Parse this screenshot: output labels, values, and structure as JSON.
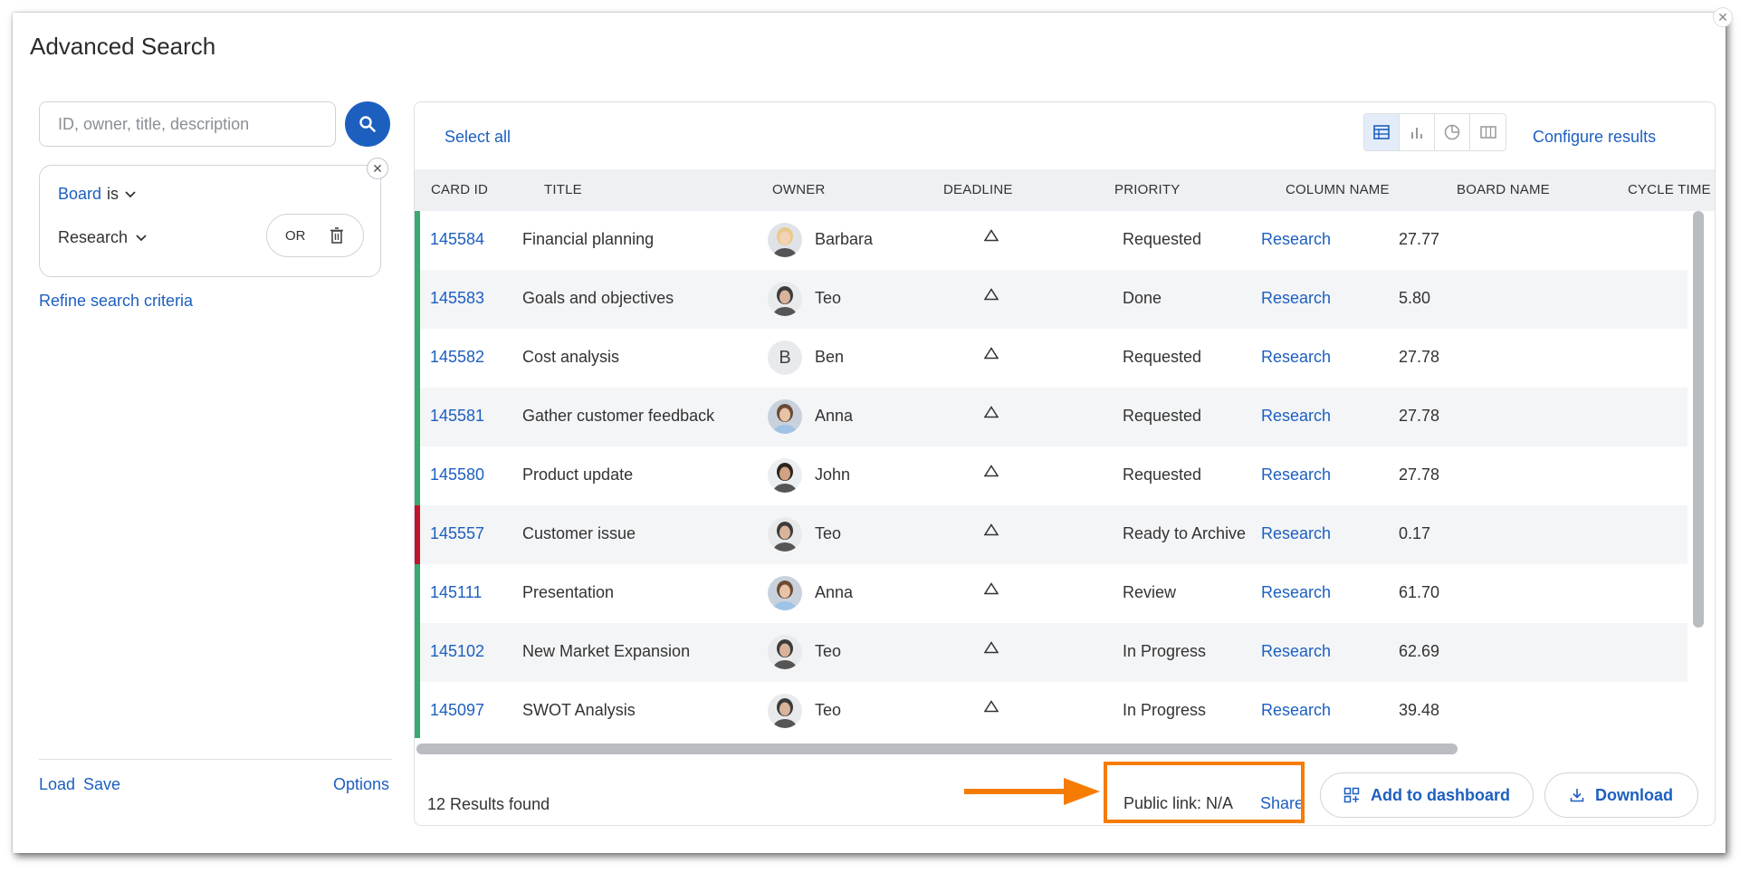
{
  "modal": {
    "title": "Advanced Search"
  },
  "search": {
    "placeholder": "ID, owner, title, description",
    "value": ""
  },
  "filter": {
    "field": "Board",
    "operator": "is",
    "value": "Research",
    "logic": "OR"
  },
  "left_links": {
    "refine": "Refine search criteria",
    "load": "Load",
    "save": "Save",
    "options": "Options"
  },
  "toolbar": {
    "select_all": "Select all",
    "configure": "Configure results",
    "views": [
      "table-view-icon",
      "bar-chart-view-icon",
      "pie-chart-view-icon",
      "columns-view-icon"
    ],
    "active_view": "table-view-icon"
  },
  "table": {
    "headers": [
      "CARD ID",
      "TITLE",
      "OWNER",
      "DEADLINE",
      "PRIORITY",
      "COLUMN NAME",
      "BOARD NAME",
      "CYCLE TIME"
    ],
    "rows": [
      {
        "id": "145584",
        "title": "Financial planning",
        "owner": "Barbara",
        "avatar": "photo-blonde",
        "deadline": "",
        "column": "Requested",
        "board": "Research",
        "cycle": "27.77",
        "stripe": "#3aaa6e"
      },
      {
        "id": "145583",
        "title": "Goals and objectives",
        "owner": "Teo",
        "avatar": "photo-teo",
        "deadline": "",
        "column": "Done",
        "board": "Research",
        "cycle": "5.80",
        "stripe": "#3aaa6e"
      },
      {
        "id": "145582",
        "title": "Cost analysis",
        "owner": "Ben",
        "avatar": "letter-B",
        "deadline": "",
        "column": "Requested",
        "board": "Research",
        "cycle": "27.78",
        "stripe": "#3aaa6e"
      },
      {
        "id": "145581",
        "title": "Gather customer feedback",
        "owner": "Anna",
        "avatar": "photo-anna",
        "deadline": "",
        "column": "Requested",
        "board": "Research",
        "cycle": "27.78",
        "stripe": "#3aaa6e"
      },
      {
        "id": "145580",
        "title": "Product update",
        "owner": "John",
        "avatar": "photo-john",
        "deadline": "",
        "column": "Requested",
        "board": "Research",
        "cycle": "27.78",
        "stripe": "#3aaa6e"
      },
      {
        "id": "145557",
        "title": "Customer issue",
        "owner": "Teo",
        "avatar": "photo-teo",
        "deadline": "",
        "column": "Ready to Archive",
        "board": "Research",
        "cycle": "0.17",
        "stripe": "#c0142c"
      },
      {
        "id": "145111",
        "title": "Presentation",
        "owner": "Anna",
        "avatar": "photo-anna",
        "deadline": "",
        "column": "Review",
        "board": "Research",
        "cycle": "61.70",
        "stripe": "#3aaa6e"
      },
      {
        "id": "145102",
        "title": "New Market Expansion",
        "owner": "Teo",
        "avatar": "photo-teo",
        "deadline": "",
        "column": "In Progress",
        "board": "Research",
        "cycle": "62.69",
        "stripe": "#3aaa6e"
      },
      {
        "id": "145097",
        "title": "SWOT Analysis",
        "owner": "Teo",
        "avatar": "photo-teo",
        "deadline": "",
        "column": "In Progress",
        "board": "Research",
        "cycle": "39.48",
        "stripe": "#3aaa6e"
      }
    ]
  },
  "footer": {
    "count": "12 Results found",
    "public_link": "Public link: N/A",
    "share": "Share",
    "add_dashboard": "Add to dashboard",
    "download": "Download"
  },
  "colors": {
    "accent": "#1d5fbf",
    "highlight": "#f57c00",
    "stripe_green": "#3aaa6e",
    "stripe_red": "#c0142c"
  }
}
